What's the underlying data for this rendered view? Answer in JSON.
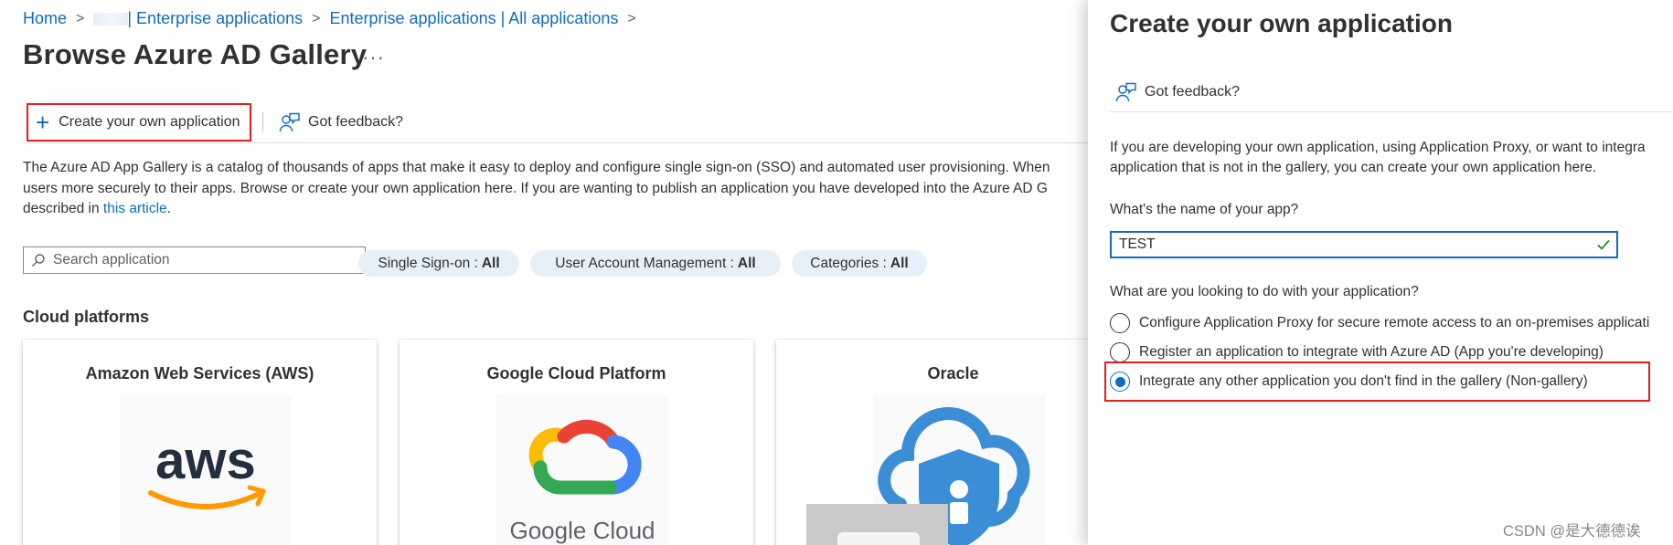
{
  "breadcrumb": {
    "home": "Home",
    "tenant_suffix": "| Enterprise applications",
    "enterprise_all": "Enterprise applications | All applications",
    "separator": ">"
  },
  "page": {
    "title": "Browse Azure AD Gallery",
    "more": "···"
  },
  "toolbar": {
    "create_label": "Create your own application",
    "feedback_label": "Got feedback?"
  },
  "description": {
    "line1": "The Azure AD App Gallery is a catalog of thousands of apps that make it easy to deploy and configure single sign-on (SSO) and automated user provisioning. When",
    "line2": "users more securely to their apps. Browse or create your own application here. If you are wanting to publish an application you have developed into the Azure AD G",
    "line3_prefix": "described in ",
    "link": "this article",
    "line3_suffix": "."
  },
  "search": {
    "placeholder": "Search application"
  },
  "filters": [
    {
      "name": "Single Sign-on :",
      "value": "All"
    },
    {
      "name": "User Account Management :",
      "value": "All"
    },
    {
      "name": "Categories :",
      "value": "All"
    }
  ],
  "cloud": {
    "section_title": "Cloud platforms",
    "cards": [
      {
        "title": "Amazon Web Services (AWS)",
        "logo_text": "aws"
      },
      {
        "title": "Google Cloud Platform",
        "logo_text": "Google Cloud"
      },
      {
        "title": "Oracle"
      }
    ]
  },
  "panel": {
    "title": "Create your own application",
    "feedback_label": "Got feedback?",
    "intro_line1": "If you are developing your own application, using Application Proxy, or want to integra",
    "intro_line2": "application that is not in the gallery, you can create your own application here.",
    "name_label": "What's the name of your app?",
    "name_value": "TEST",
    "purpose_label": "What are you looking to do with your application?",
    "options": [
      {
        "label": "Configure Application Proxy for secure remote access to an on-premises applicati",
        "selected": false
      },
      {
        "label": "Register an application to integrate with Azure AD (App you're developing)",
        "selected": false
      },
      {
        "label": "Integrate any other application you don't find in the gallery (Non-gallery)",
        "selected": true
      }
    ]
  },
  "watermark": "CSDN @是大德德诶",
  "colors": {
    "accent": "#0f6cbd",
    "highlight_red": "#e0201f",
    "pill_bg": "#e6f0f9",
    "check_green": "#107c10"
  }
}
